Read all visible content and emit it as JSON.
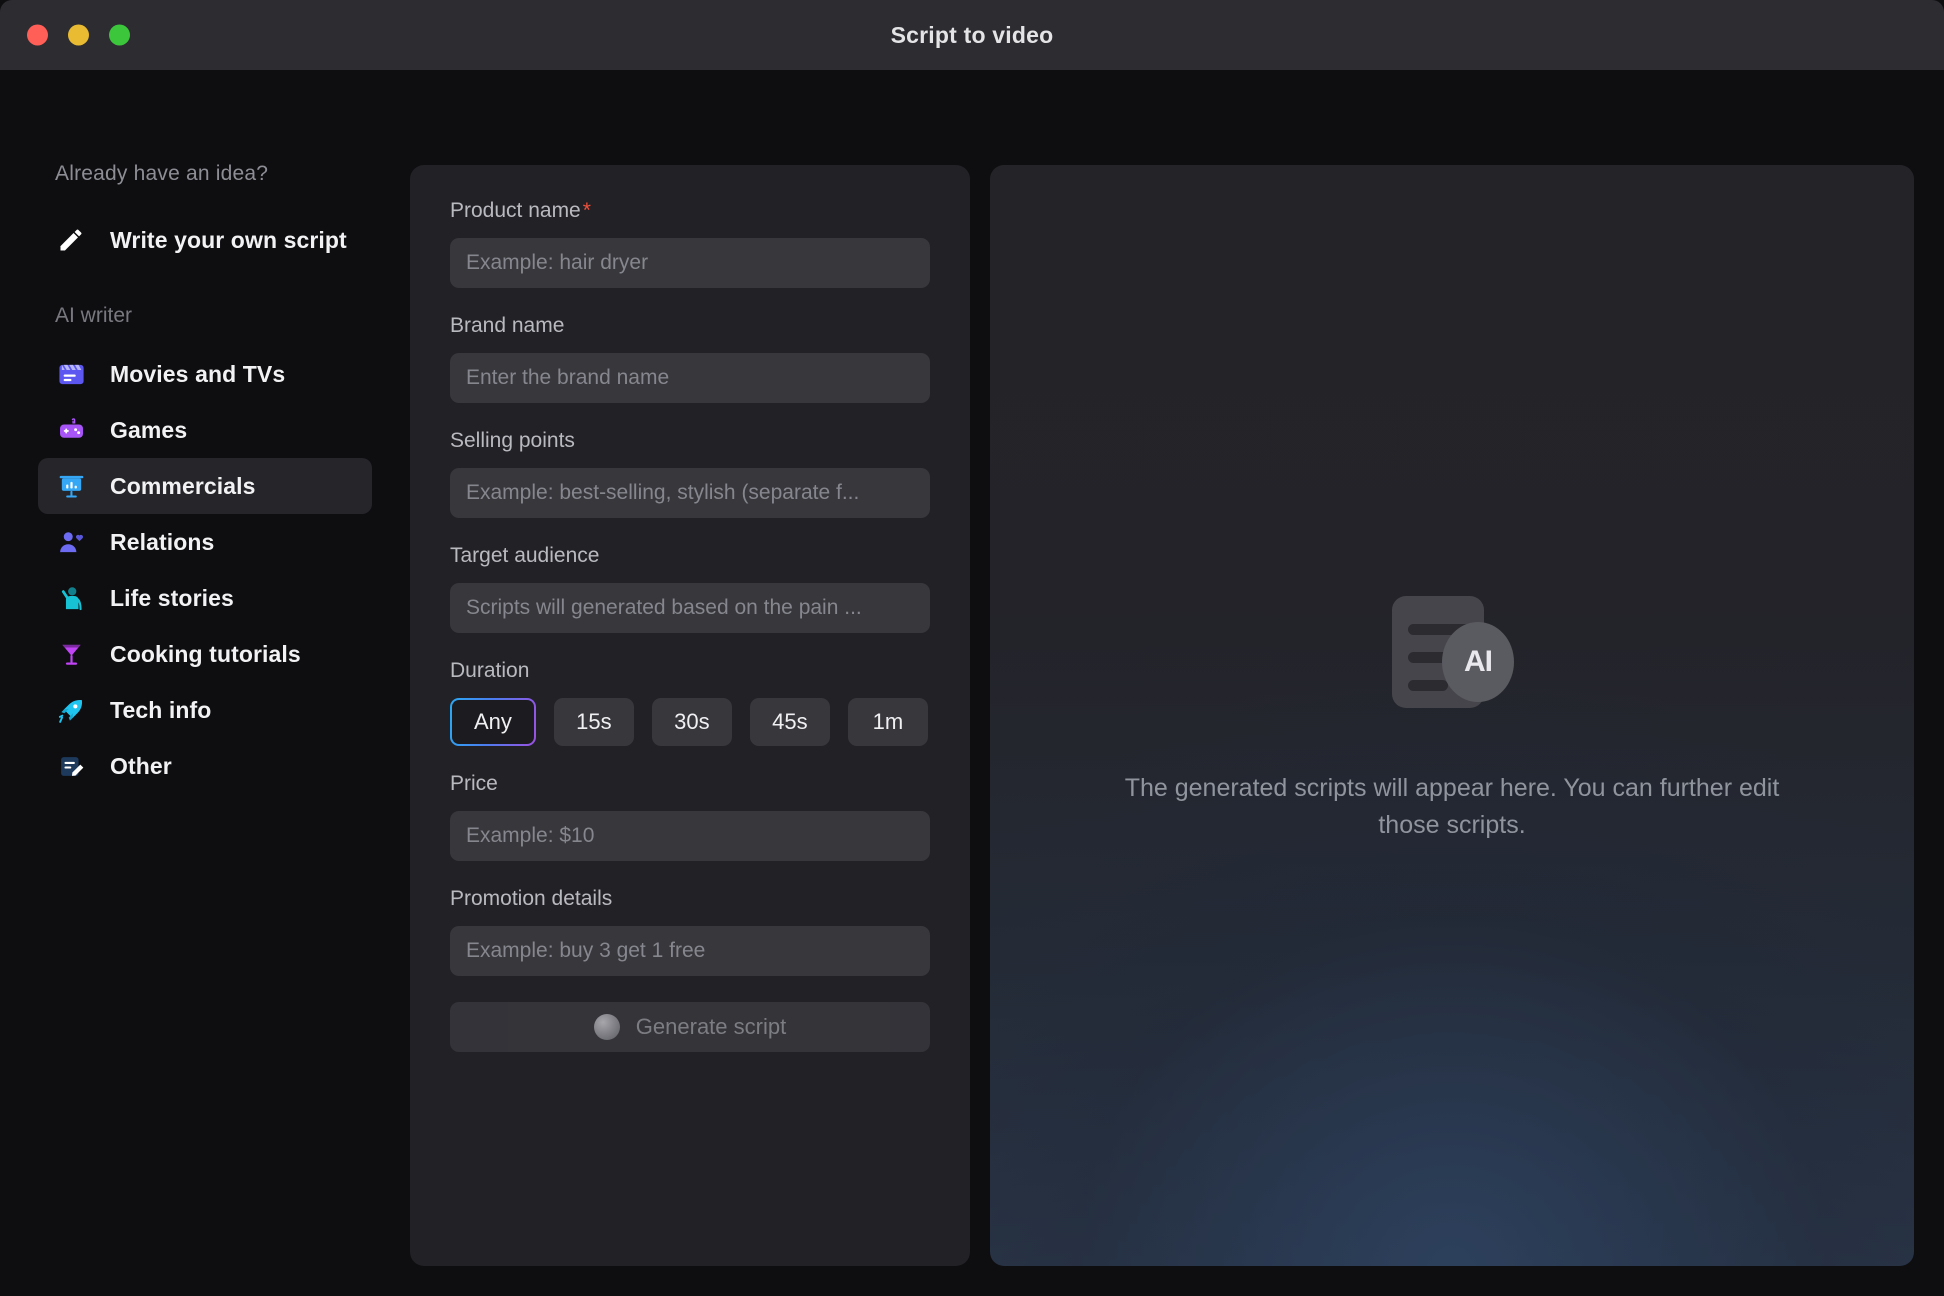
{
  "window": {
    "title": "Script to video",
    "controls": [
      "close",
      "minimize",
      "maximize"
    ]
  },
  "sidebar": {
    "heading": "Already have an idea?",
    "write_own": {
      "label": "Write your own script",
      "icon": "pencil-icon"
    },
    "section_label": "AI writer",
    "items": [
      {
        "label": "Movies and TVs",
        "icon": "clapperboard-icon",
        "selected": false
      },
      {
        "label": "Games",
        "icon": "gamepad-icon",
        "selected": false
      },
      {
        "label": "Commercials",
        "icon": "presentation-icon",
        "selected": true
      },
      {
        "label": "Relations",
        "icon": "person-heart-icon",
        "selected": false
      },
      {
        "label": "Life stories",
        "icon": "person-wave-icon",
        "selected": false
      },
      {
        "label": "Cooking tutorials",
        "icon": "cocktail-icon",
        "selected": false
      },
      {
        "label": "Tech info",
        "icon": "rocket-icon",
        "selected": false
      },
      {
        "label": "Other",
        "icon": "note-edit-icon",
        "selected": false
      }
    ]
  },
  "form": {
    "product_name": {
      "label": "Product name",
      "required_marker": "*",
      "value": "",
      "placeholder": "Example: hair dryer"
    },
    "brand_name": {
      "label": "Brand name",
      "value": "",
      "placeholder": "Enter the brand name"
    },
    "selling_points": {
      "label": "Selling points",
      "value": "",
      "placeholder": "Example: best-selling, stylish (separate f..."
    },
    "target_audience": {
      "label": "Target audience",
      "value": "",
      "placeholder": "Scripts will generated based on the pain ..."
    },
    "duration": {
      "label": "Duration",
      "options": [
        "Any",
        "15s",
        "30s",
        "45s",
        "1m"
      ],
      "selected": "Any"
    },
    "price": {
      "label": "Price",
      "value": "",
      "placeholder": "Example: $10"
    },
    "promotion_details": {
      "label": "Promotion details",
      "value": "",
      "placeholder": "Example: buy 3 get 1 free"
    },
    "generate_button": {
      "label": "Generate script",
      "icon": "loading-spinner-icon",
      "disabled": true
    }
  },
  "preview": {
    "icon": "ai-document-icon",
    "icon_badge_text": "AI",
    "empty_text": "The generated scripts will appear here. You can further edit those scripts."
  },
  "colors": {
    "accent_blue": "#2aa8f2",
    "accent_purple": "#9b51e0",
    "required_red": "#f2503c",
    "panel_bg": "#222226",
    "window_bg": "#0e0e11",
    "titlebar_bg": "#2c2c31"
  }
}
